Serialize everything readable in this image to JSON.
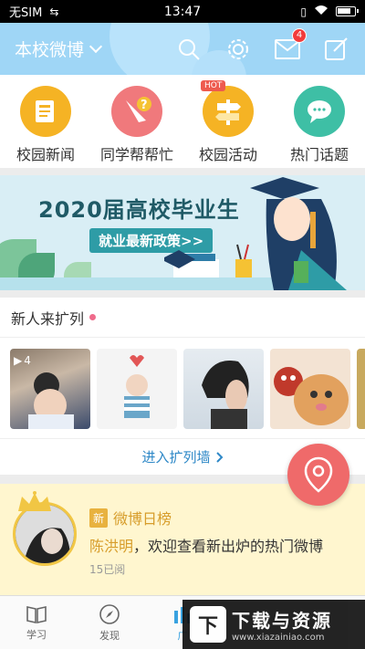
{
  "status_bar": {
    "carrier": "无SIM",
    "time": "13:47"
  },
  "header": {
    "title": "本校微博",
    "message_badge": "4"
  },
  "quick_nav": [
    {
      "label": "校园新闻",
      "icon": "news-icon",
      "color": "#f5b324"
    },
    {
      "label": "同学帮帮忙",
      "icon": "help-icon",
      "color": "#f0797c"
    },
    {
      "label": "校园活动",
      "icon": "signpost-icon",
      "color": "#f5b324",
      "badge": "HOT"
    },
    {
      "label": "热门话题",
      "icon": "chat-icon",
      "color": "#3ebfa5"
    }
  ],
  "banner": {
    "title": "2020届高校毕业生",
    "subtitle": "就业最新政策>>"
  },
  "new_members": {
    "title": "新人来扩列",
    "video_count": "4",
    "more_label": "进入扩列墙"
  },
  "weibo": {
    "tag": "新",
    "name": "微博日榜",
    "user": "陈洪明",
    "text": "，欢迎查看新出炉的热门微博",
    "reads": "15已阅"
  },
  "tabs": [
    {
      "label": "学习",
      "icon": "book-icon"
    },
    {
      "label": "发现",
      "icon": "compass-icon"
    },
    {
      "label": "广",
      "icon": "square-icon"
    }
  ],
  "watermark": {
    "logo": "下",
    "text": "下载与资源",
    "url": "www.xiazainiao.com"
  }
}
